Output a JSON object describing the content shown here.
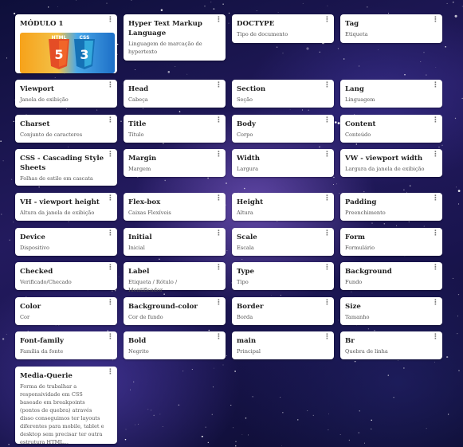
{
  "cards": [
    {
      "title": "MÓDULO 1",
      "desc": "",
      "logo": true
    },
    {
      "title": "Hyper Text Markup Language",
      "desc": "Linguagem de marcação de hypertexto"
    },
    {
      "title": "DOCTYPE",
      "desc": "Tipo de documento"
    },
    {
      "title": "Tag",
      "desc": "Etiqueta"
    },
    {
      "title": "Viewport",
      "desc": "Janela de exibição"
    },
    {
      "title": "Head",
      "desc": "Cabeça"
    },
    {
      "title": "Section",
      "desc": "Seção"
    },
    {
      "title": "Lang",
      "desc": "Linguagem"
    },
    {
      "title": "Charset",
      "desc": "Conjunto de caracteres"
    },
    {
      "title": "Title",
      "desc": "Título"
    },
    {
      "title": "Body",
      "desc": "Corpo"
    },
    {
      "title": "Content",
      "desc": "Conteúdo"
    },
    {
      "title": "CSS - Cascading Style Sheets",
      "desc": "Folhas de estilo em cascata"
    },
    {
      "title": "Margin",
      "desc": "Margem"
    },
    {
      "title": "Width",
      "desc": "Largura"
    },
    {
      "title": "VW - viewport width",
      "desc": "Largura da janela de exibição"
    },
    {
      "title": "VH - viewport height",
      "desc": "Altura da janela de exibição"
    },
    {
      "title": "Flex-box",
      "desc": "Caixas Flexíveis"
    },
    {
      "title": "Height",
      "desc": "Altura"
    },
    {
      "title": "Padding",
      "desc": "Preenchimento"
    },
    {
      "title": "Device",
      "desc": "Dispositivo"
    },
    {
      "title": "Initial",
      "desc": "Inicial"
    },
    {
      "title": "Scale",
      "desc": "Escala"
    },
    {
      "title": "Form",
      "desc": "Formulário"
    },
    {
      "title": "Checked",
      "desc": "Verificado/Checado"
    },
    {
      "title": "Label",
      "desc": "Etiqueta / Rótulo / Identificador"
    },
    {
      "title": "Type",
      "desc": "Tipo"
    },
    {
      "title": "Background",
      "desc": "Fundo"
    },
    {
      "title": "Color",
      "desc": "Cor"
    },
    {
      "title": "Background-color",
      "desc": "Cor de fundo"
    },
    {
      "title": "Border",
      "desc": "Borda"
    },
    {
      "title": "Size",
      "desc": "Tamanho"
    },
    {
      "title": "Font-family",
      "desc": "Família da fonte"
    },
    {
      "title": "Bold",
      "desc": "Negrito"
    },
    {
      "title": "main",
      "desc": "Principal"
    },
    {
      "title": "Br",
      "desc": "Quebra de linha"
    },
    {
      "title": "Media-Querie",
      "desc": "Forma de trabalhar a responsividade em CSS baseado em breakpoints (pontos de quebra) através disso conseguimos ter layouts diferentes para mobile, tablet e desktop sem precisar ter outra estrutura HTML..."
    }
  ],
  "menu_glyph": "⋮",
  "logo_text": {
    "html": "HTML",
    "css": "CSS",
    "html_num": "5",
    "css_num": "3"
  },
  "colors": {
    "html_orange": "#e44d26",
    "css_blue": "#1572b6"
  }
}
